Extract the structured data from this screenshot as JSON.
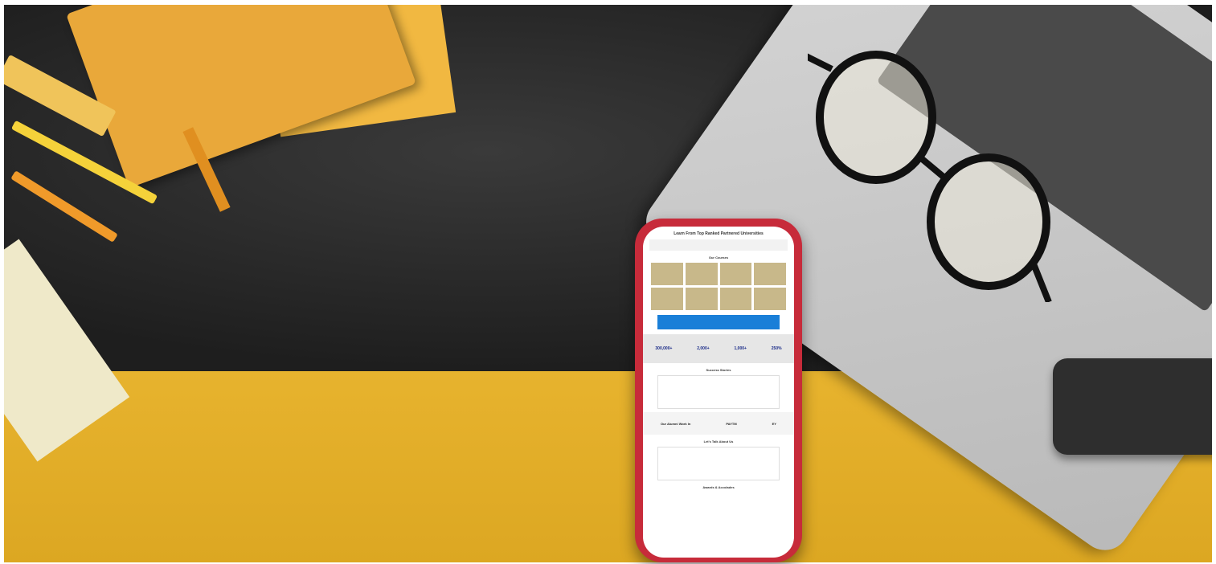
{
  "phone_screen": {
    "heading": "Learn From Top Ranked Partnered Universities",
    "section_programs": "Our Courses",
    "stats": [
      "300,000+",
      "2,000+",
      "1,000+",
      "250%"
    ],
    "section_reviews": "Success Stories",
    "section_work": "Our Alumni Work In",
    "employers": [
      "PAYTM",
      "EY"
    ],
    "section_media": "Let's Talk About Us",
    "section_awards": "Awards & Accolades"
  },
  "colors": {
    "desk_dark": "#262626",
    "desk_yellow": "#e2ad2a",
    "phone_frame": "#c72b3a",
    "banner_blue": "#1a7fd8"
  }
}
